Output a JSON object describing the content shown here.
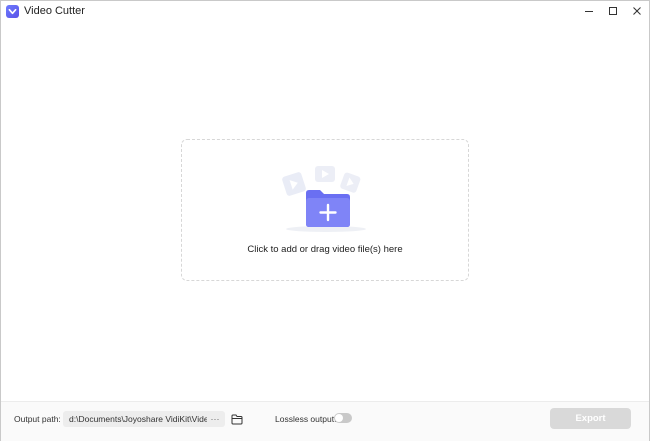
{
  "window": {
    "title": "Video Cutter"
  },
  "dropzone": {
    "text": "Click to add or drag video file(s) here"
  },
  "bottom_bar": {
    "output_label": "Output path:",
    "output_path": "d:\\Documents\\Joyoshare VidiKit\\Video",
    "more_label": "···",
    "lossless_label": "Lossless output:",
    "lossless_enabled": false,
    "export_label": "Export"
  },
  "colors": {
    "accent": "#6b6cf0",
    "export_disabled": "#d9d9d9"
  }
}
